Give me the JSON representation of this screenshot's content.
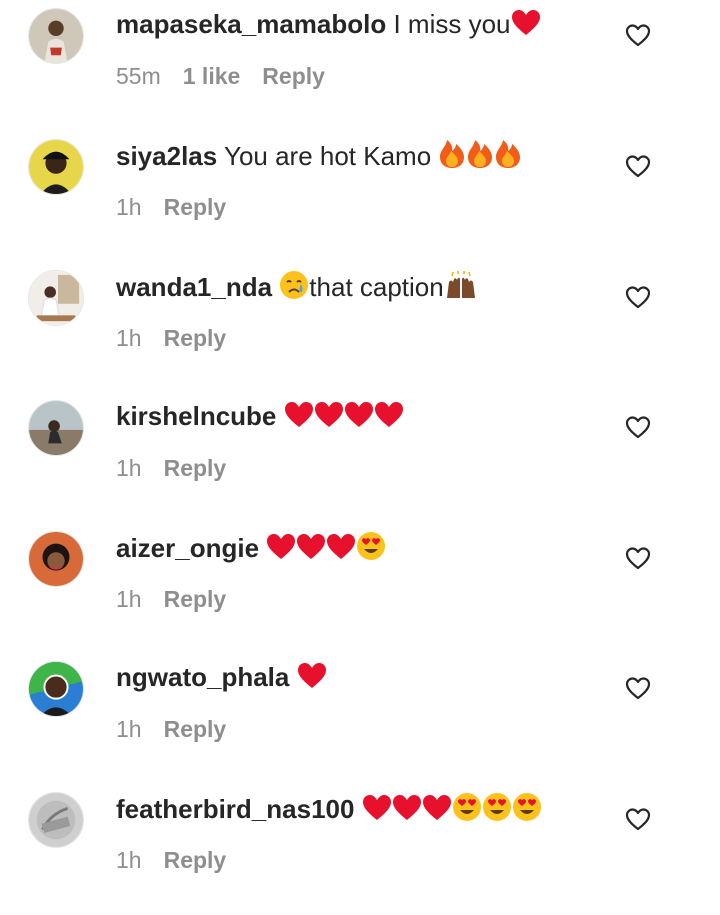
{
  "comments": [
    {
      "username": "mapaseka_mamabolo",
      "text": "I miss you",
      "emojis": [
        "red-heart"
      ],
      "time": "55m",
      "likes": "1 like",
      "reply": "Reply"
    },
    {
      "username": "siya2las",
      "text": "You are hot Kamo",
      "emojis": [
        "fire",
        "fire",
        "fire"
      ],
      "time": "1h",
      "likes": "",
      "reply": "Reply"
    },
    {
      "username": "wanda1_nda",
      "text": "that caption",
      "emojis": [
        "crying-face",
        "raising-hands"
      ],
      "time": "1h",
      "likes": "",
      "reply": "Reply"
    },
    {
      "username": "kirshelncube",
      "text": "",
      "emojis": [
        "red-heart",
        "red-heart",
        "red-heart",
        "red-heart"
      ],
      "time": "1h",
      "likes": "",
      "reply": "Reply"
    },
    {
      "username": "aizer_ongie",
      "text": "",
      "emojis": [
        "red-heart",
        "red-heart",
        "red-heart",
        "heart-eyes"
      ],
      "time": "1h",
      "likes": "",
      "reply": "Reply"
    },
    {
      "username": "ngwato_phala",
      "text": "",
      "emojis": [
        "red-heart"
      ],
      "time": "1h",
      "likes": "",
      "reply": "Reply"
    },
    {
      "username": "featherbird_nas100",
      "text": "",
      "emojis": [
        "red-heart",
        "red-heart",
        "red-heart",
        "heart-eyes",
        "heart-eyes",
        "heart-eyes"
      ],
      "time": "1h",
      "likes": "",
      "reply": "Reply"
    }
  ],
  "icons": {
    "like_button": "heart-outline-icon"
  },
  "colors": {
    "text": "#262626",
    "meta": "#8e8e8e",
    "heart_red": "#e8112d"
  }
}
